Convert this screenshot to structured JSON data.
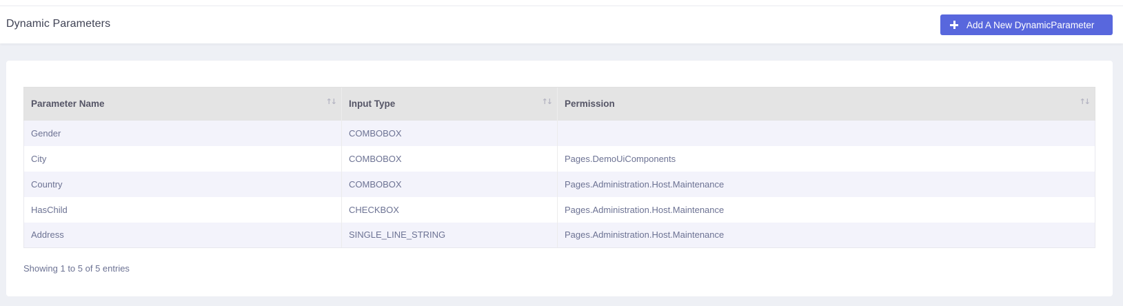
{
  "header": {
    "title": "Dynamic Parameters",
    "add_button_label": "Add A New DynamicParameter",
    "add_button_icon": "plus-icon",
    "accent_color": "#5867dd"
  },
  "table": {
    "columns": [
      {
        "label": "Parameter Name",
        "sort_icon": "sort-icon"
      },
      {
        "label": "Input Type",
        "sort_icon": "sort-icon"
      },
      {
        "label": "Permission",
        "sort_icon": "sort-icon"
      }
    ],
    "rows": [
      {
        "name": "Gender",
        "input_type": "COMBOBOX",
        "permission": ""
      },
      {
        "name": "City",
        "input_type": "COMBOBOX",
        "permission": "Pages.DemoUiComponents"
      },
      {
        "name": "Country",
        "input_type": "COMBOBOX",
        "permission": "Pages.Administration.Host.Maintenance"
      },
      {
        "name": "HasChild",
        "input_type": "CHECKBOX",
        "permission": "Pages.Administration.Host.Maintenance"
      },
      {
        "name": "Address",
        "input_type": "SINGLE_LINE_STRING",
        "permission": "Pages.Administration.Host.Maintenance"
      }
    ]
  },
  "footer": {
    "info": "Showing 1 to 5 of 5 entries"
  }
}
